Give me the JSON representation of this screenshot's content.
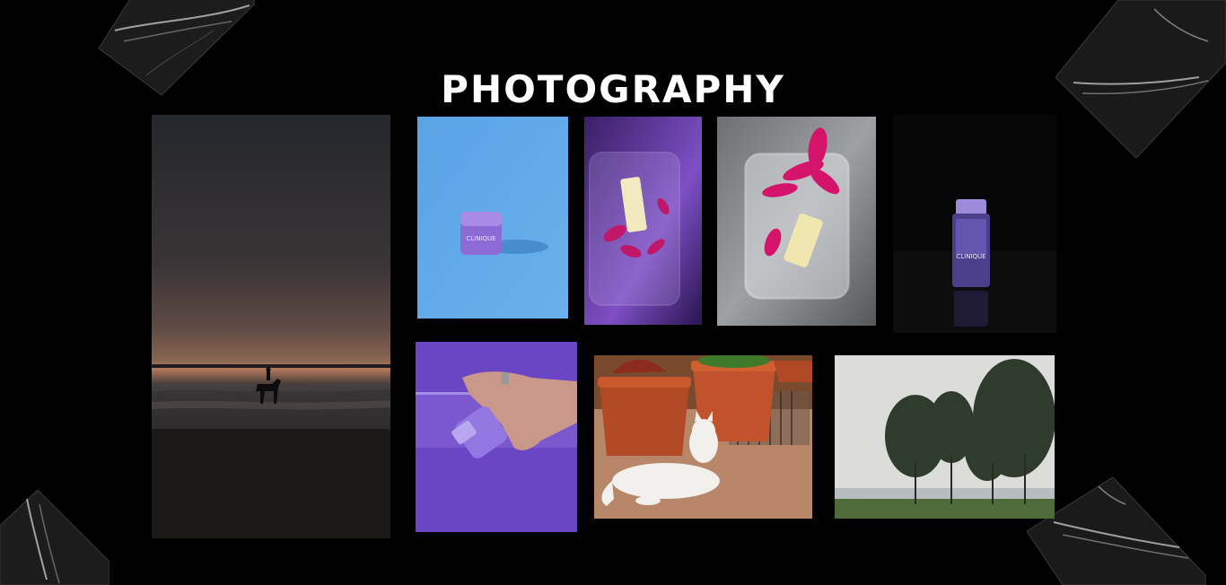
{
  "page": {
    "title": "PHOTOGRAPHY",
    "background": "#000000"
  },
  "gallery": {
    "photos": [
      {
        "subject": "beach-sunset-horse-rider"
      },
      {
        "subject": "cream-jar-on-blue"
      },
      {
        "subject": "tube-in-glass-dish-purple"
      },
      {
        "subject": "tube-with-pink-flowers-in-glass-dish"
      },
      {
        "subject": "bottle-on-black"
      },
      {
        "subject": "hand-holding-bottle-in-water"
      },
      {
        "subject": "white-cat-by-flower-pots"
      },
      {
        "subject": "trees-by-the-shore"
      }
    ]
  },
  "product_labels": {
    "brand": "CLINIQUE"
  }
}
